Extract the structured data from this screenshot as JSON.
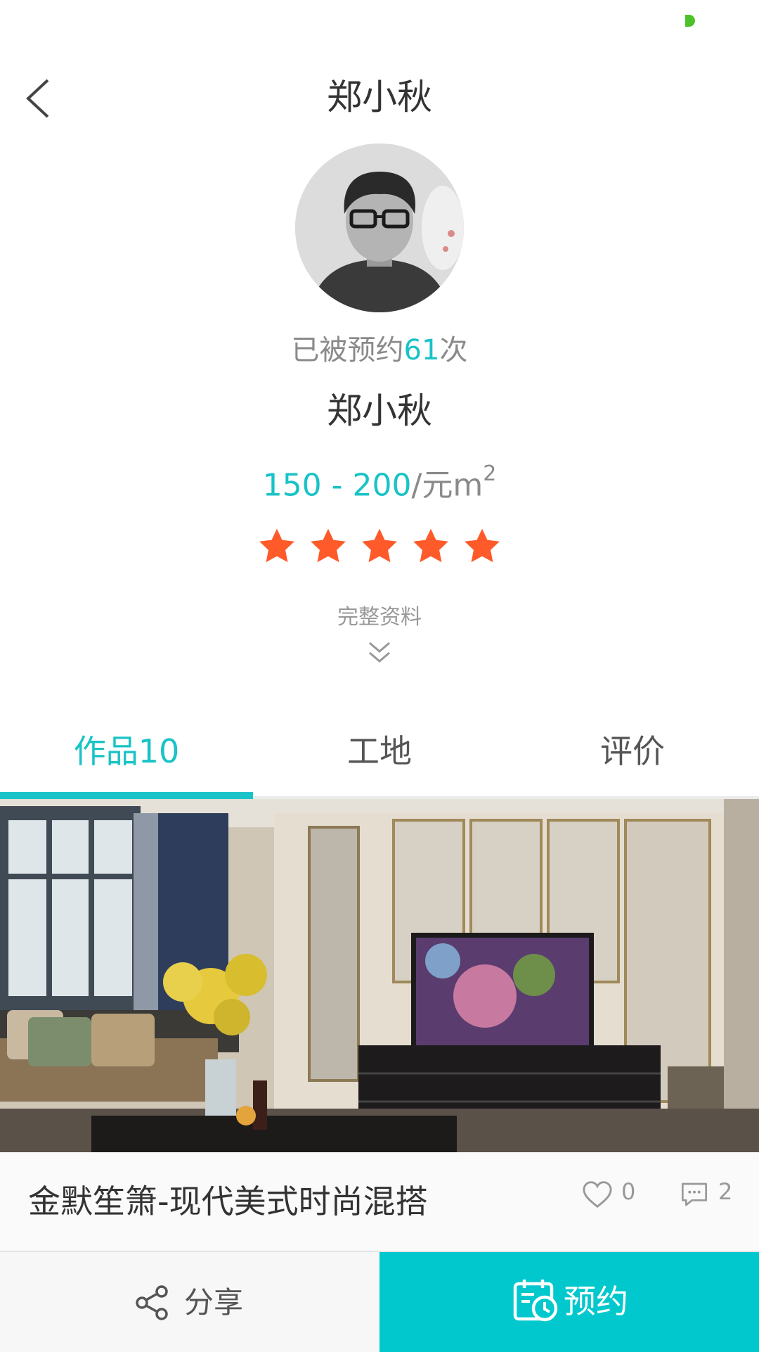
{
  "header": {
    "title": "郑小秋"
  },
  "profile": {
    "booked_prefix": "已被预约",
    "booked_count": "61",
    "booked_suffix": "次",
    "name": "郑小秋",
    "price_range": "150 - 200",
    "price_unit": "/元m",
    "price_unit_sup": "2",
    "rating": 5,
    "full_profile_label": "完整资料"
  },
  "tabs": [
    {
      "label": "作品10",
      "active": true
    },
    {
      "label": "工地",
      "active": false
    },
    {
      "label": "评价",
      "active": false
    }
  ],
  "work": {
    "title": "金默笙箫-现代美式时尚混搭",
    "likes": "0",
    "comments": "2"
  },
  "bottom_bar": {
    "share_label": "分享",
    "book_label": "预约"
  },
  "colors": {
    "accent": "#19c3c7",
    "star": "#ff5a2a",
    "book_button": "#00c8cc"
  }
}
